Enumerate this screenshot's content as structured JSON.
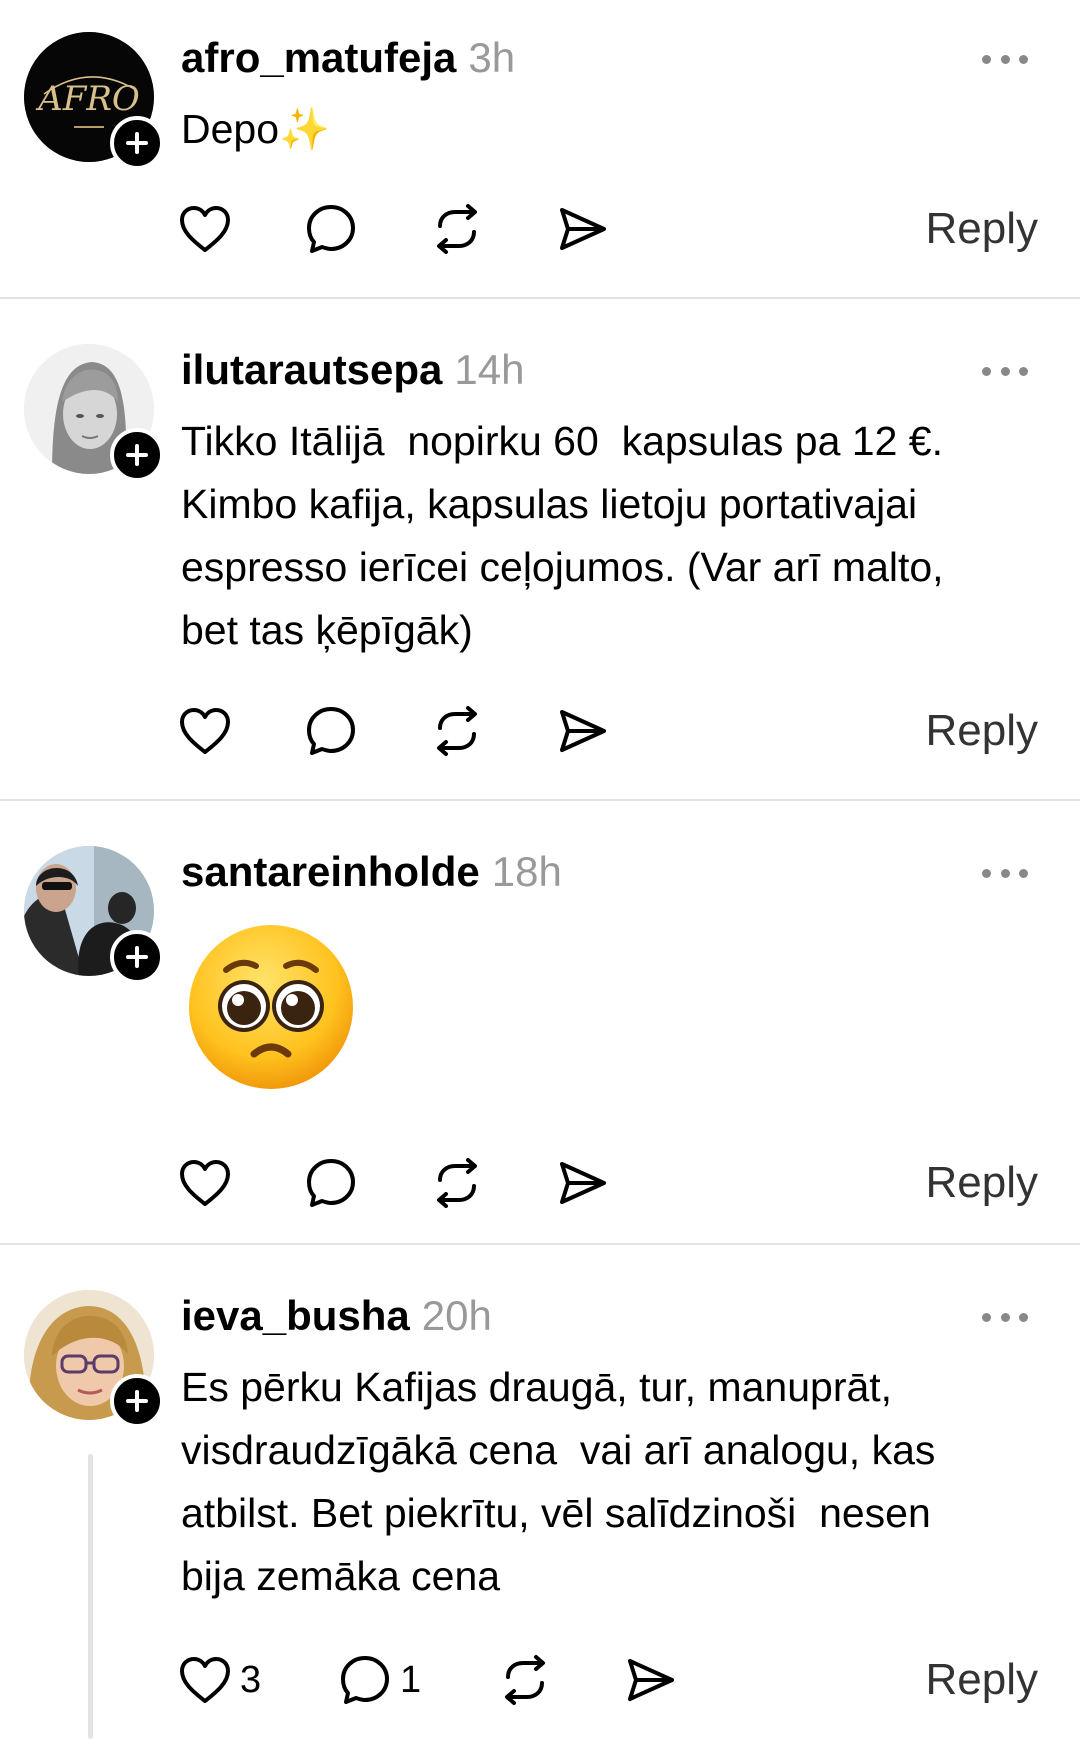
{
  "posts": [
    {
      "username": "afro_matufeja",
      "time": "3h",
      "text": "Depo✨",
      "avatar_icon": "afro-logo-avatar",
      "likes": "",
      "replies": "",
      "reply_label": "Reply"
    },
    {
      "username": "ilutarautsepa",
      "time": "14h",
      "text": "Tikko Itālijā  nopirku 60  kapsulas pa 12 €.\nKimbo kafija, kapsulas lietoju portativajai\nespresso ierīcei ceļojumos. (Var arī malto,\nbet tas ķēpīgāk)",
      "avatar_icon": "woman-portrait-avatar",
      "likes": "",
      "replies": "",
      "reply_label": "Reply"
    },
    {
      "username": "santareinholde",
      "time": "18h",
      "text": "🥺",
      "avatar_icon": "woman-with-dog-avatar",
      "likes": "",
      "replies": "",
      "reply_label": "Reply"
    },
    {
      "username": "ieva_busha",
      "time": "20h",
      "text": "Es pērku Kafijas draugā, tur, manuprāt,\nvisdraudzīgākā cena  vai arī analogu, kas\natbilst. Bet piekrītu, vēl salīdzinoši  nesen\nbija zemāka cena",
      "avatar_icon": "woman-glasses-avatar",
      "likes": "3",
      "replies": "1",
      "reply_label": "Reply"
    }
  ],
  "logo_text": "AFRO",
  "colors": {
    "text": "#000000",
    "muted": "#999999",
    "divider": "#e3e3e3",
    "reply": "#333333"
  }
}
